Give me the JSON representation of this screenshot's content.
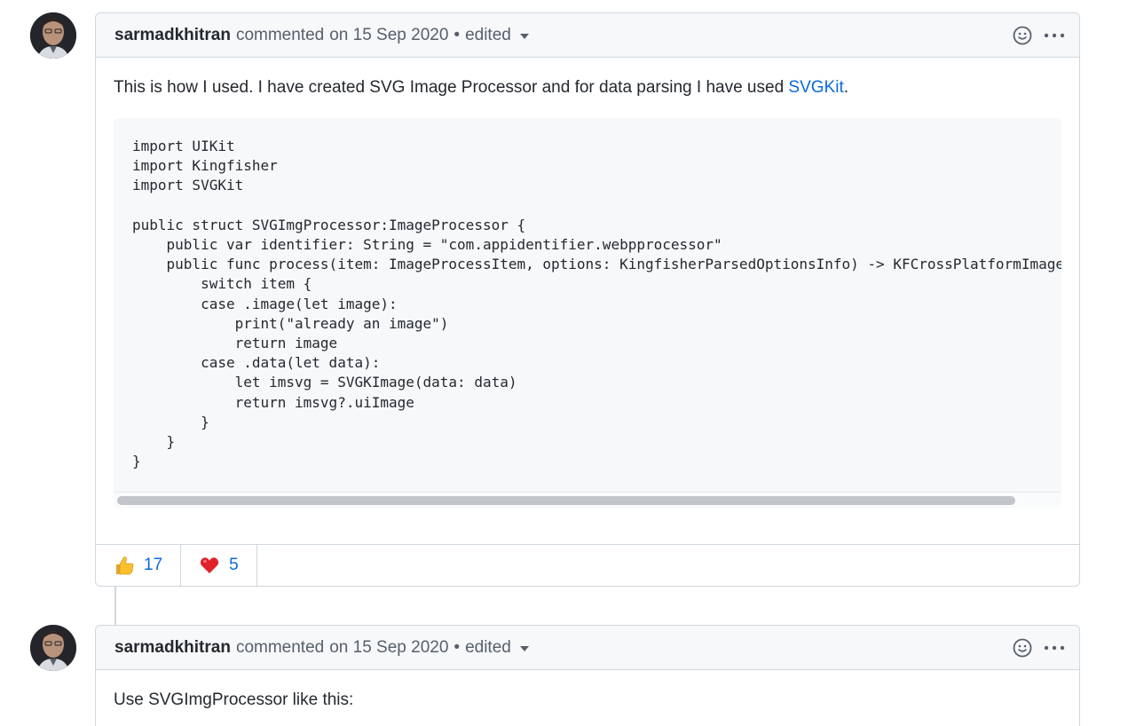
{
  "comments": [
    {
      "author": "sarmadkhitran",
      "action": "commented",
      "date": "on 15 Sep 2020",
      "separator": "•",
      "edited": "edited",
      "body_text": "This is how I used. I have created SVG Image Processor and for data parsing I have used ",
      "body_link": "SVGKit",
      "body_end": ".",
      "code": "import UIKit\nimport Kingfisher\nimport SVGKit\n\npublic struct SVGImgProcessor:ImageProcessor {\n    public var identifier: String = \"com.appidentifier.webpprocessor\"\n    public func process(item: ImageProcessItem, options: KingfisherParsedOptionsInfo) -> KFCrossPlatformImage? {\n        switch item {\n        case .image(let image):\n            print(\"already an image\")\n            return image\n        case .data(let data):\n            let imsvg = SVGKImage(data: data)\n            return imsvg?.uiImage\n        }\n    }\n}",
      "reactions": [
        {
          "emoji": "thumbs-up",
          "count": "17"
        },
        {
          "emoji": "heart",
          "count": "5"
        }
      ]
    },
    {
      "author": "sarmadkhitran",
      "action": "commented",
      "date": "on 15 Sep 2020",
      "separator": "•",
      "edited": "edited",
      "body_text": "Use SVGImgProcessor like this:"
    }
  ],
  "icons": {
    "reaction_picker": "smiley-icon",
    "more_options": "kebab-horizontal-icon",
    "edited_dropdown": "triangle-down-icon"
  },
  "colors": {
    "link": "#0969da",
    "header_bg": "#f6f8fa",
    "border": "#d0d7de",
    "muted_text": "#57606a"
  }
}
